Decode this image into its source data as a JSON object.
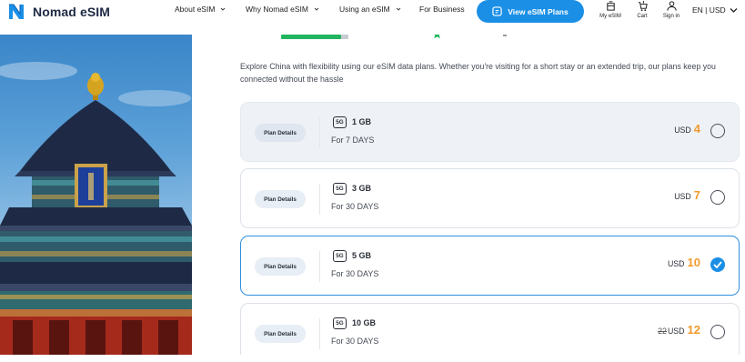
{
  "header": {
    "brand": "Nomad eSIM",
    "nav": [
      {
        "label": "About eSIM",
        "has_dropdown": true
      },
      {
        "label": "Why Nomad eSIM",
        "has_dropdown": true
      },
      {
        "label": "Using an eSIM",
        "has_dropdown": true
      },
      {
        "label": "For Business",
        "has_dropdown": false
      }
    ],
    "cta_label": "View eSIM Plans",
    "icons": [
      {
        "label": "My eSIM",
        "icon": "sim-icon"
      },
      {
        "label": "Cart",
        "icon": "cart-icon"
      },
      {
        "label": "Sign in",
        "icon": "user-icon"
      }
    ],
    "language": "EN | USD"
  },
  "main": {
    "intro": "Explore China with flexibility using our eSIM data plans. Whether you're visiting for a short stay or an extended trip, our plans keep you connected without the hassle",
    "plans": [
      {
        "details_label": "Plan Details",
        "network": "5G",
        "data": "1 GB",
        "duration": "For 7 DAYS",
        "old_price": "",
        "currency": "USD",
        "price": "4",
        "selected": false
      },
      {
        "details_label": "Plan Details",
        "network": "5G",
        "data": "3 GB",
        "duration": "For 30 DAYS",
        "old_price": "",
        "currency": "USD",
        "price": "7",
        "selected": false
      },
      {
        "details_label": "Plan Details",
        "network": "5G",
        "data": "5 GB",
        "duration": "For 30 DAYS",
        "old_price": "",
        "currency": "USD",
        "price": "10",
        "selected": true
      },
      {
        "details_label": "Plan Details",
        "network": "5G",
        "data": "10 GB",
        "duration": "For 30 DAYS",
        "old_price": "22",
        "currency": "USD",
        "price": "12",
        "selected": false
      }
    ]
  },
  "colors": {
    "accent": "#1b8fe6",
    "price": "#f39a2c",
    "rating_green": "#22b45e",
    "brand_text": "#1f2a44"
  }
}
